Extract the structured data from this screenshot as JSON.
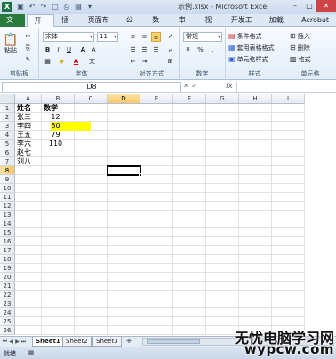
{
  "window": {
    "title": "示例.xlsx - Microsoft Excel",
    "app_icon": "X",
    "quick_access": [
      "save-icon",
      "undo-icon",
      "redo-icon",
      "new-icon",
      "print-preview-icon",
      "open-icon"
    ],
    "controls": [
      "minimize-icon",
      "maximize-icon",
      "close-icon"
    ]
  },
  "ribbon": {
    "file_tab": "文件",
    "tabs": [
      "开始",
      "插入",
      "页面布局",
      "公式",
      "数据",
      "审阅",
      "视图",
      "开发工具",
      "加载项",
      "Acrobat"
    ],
    "active_tab": "开始",
    "clipboard": {
      "paste_label": "粘贴",
      "group_label": "剪贴板"
    },
    "font": {
      "font_name": "宋体",
      "font_size": "11",
      "bold": "B",
      "italic": "I",
      "underline": "U",
      "group_label": "字体",
      "grow": "A",
      "shrink": "A",
      "color_label": "A",
      "phonetic": "文"
    },
    "alignment": {
      "group_label": "对齐方式"
    },
    "number": {
      "format": "常规",
      "percent": "%",
      "comma": ",",
      "group_label": "数字"
    },
    "styles": {
      "conditional": "条件格式",
      "table_format": "套用表格格式",
      "cell_styles": "单元格样式",
      "group_label": "样式"
    },
    "cells": {
      "insert": "插入",
      "delete": "删除",
      "format": "格式",
      "group_label": "单元格"
    }
  },
  "formula_bar": {
    "name_box": "D8",
    "fx_label": "fx",
    "content": ""
  },
  "grid": {
    "columns": [
      "A",
      "B",
      "C",
      "D",
      "E",
      "F",
      "G",
      "H",
      "I"
    ],
    "rows": [
      "1",
      "2",
      "3",
      "4",
      "5",
      "6",
      "7",
      "8",
      "9",
      "10",
      "11",
      "12",
      "13",
      "14",
      "15",
      "16",
      "17",
      "18",
      "19",
      "20",
      "21",
      "22",
      "23",
      "24",
      "25",
      "26"
    ],
    "selected_cell": "D8",
    "cells": {
      "A1": "姓名",
      "B1": "数学",
      "A2": "张三",
      "B2": "12",
      "A3": "李四",
      "B3": "80",
      "A4": "王五",
      "B4": "79",
      "A5": "李六",
      "B5": "110",
      "A6": "赵七",
      "A7": "刘八"
    },
    "highlight_color": "#ffff00"
  },
  "sheets": {
    "tabs": [
      "Sheet1",
      "Sheet2",
      "Sheet3"
    ],
    "active": "Sheet1"
  },
  "status": {
    "text": "就绪"
  },
  "watermark": {
    "line1": "无忧电脑学习网",
    "line2": "wypcw.com"
  }
}
